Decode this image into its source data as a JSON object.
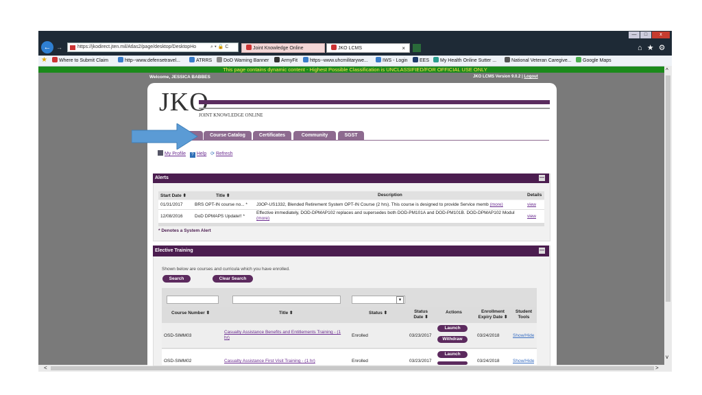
{
  "browser": {
    "url": "https://jkodirect.jten.mil/Atlas2/page/desktop/DesktopHo",
    "search_glyph": "⌕ ▾ 🔒 C",
    "tabs": [
      {
        "label": "Joint Knowledge Online"
      },
      {
        "label": "JKO LCMS"
      }
    ],
    "tab_close": "×",
    "favorites": [
      {
        "label": "Where to Submit Claim"
      },
      {
        "label": "http--www.defensetravel..."
      },
      {
        "label": "ATRRS"
      },
      {
        "label": "DoD Warning Banner"
      },
      {
        "label": "ArmyFit"
      },
      {
        "label": "https--www.uhcmilitarywe..."
      },
      {
        "label": "IWS - Login"
      },
      {
        "label": "EES"
      },
      {
        "label": "My Health Online  Sutter ..."
      },
      {
        "label": "National Veteran Caregive..."
      },
      {
        "label": "Google Maps"
      }
    ],
    "toolbar_icons": "⌂ ★ ⚙",
    "window_buttons": {
      "min": "—",
      "max": "□",
      "close": "x"
    }
  },
  "banner": {
    "text": "This page contains dynamic content - Highest Possible Classification is UNCLASSIFIED/FOR OFFICIAL USE ONLY"
  },
  "header": {
    "welcome": "Welcome, JESSICA BABBES",
    "version": "JKO LCMS Version 9.0.2 |",
    "logout": "Logout",
    "logo": "JKO",
    "logo_sub": "JOINT KNOWLEDGE ONLINE"
  },
  "nav": {
    "tabs": [
      {
        "label": "Course Catalog"
      },
      {
        "label": "Certificates"
      },
      {
        "label": "Community"
      },
      {
        "label": "SGST"
      }
    ]
  },
  "links": {
    "profile": "My Profile",
    "help": "Help",
    "refresh": "Refresh"
  },
  "alerts": {
    "title": "Alerts",
    "collapse": "—",
    "columns": [
      "Start Date ⬍",
      "Title ⬍",
      "Description",
      "Details"
    ],
    "rows": [
      {
        "date": "01/31/2017",
        "title": "BRS OPT-IN course no... *",
        "desc": "J3OP-US1332, Blended Retirement System OPT-IN Course (2 hrs). This course is designed to provide Service memb",
        "more": "(more)",
        "details": "view"
      },
      {
        "date": "12/08/2016",
        "title": "DoD DPMAPS Update!! *",
        "desc": "Effective immediately, DOD-DPMAP102 replaces and supersedes both DOD-PM101A and DOD-PM101B. DOD-DPMAP102 Modul",
        "more": "(more)",
        "details": "view"
      }
    ],
    "footnote": "* Denotes a System Alert"
  },
  "elective": {
    "title": "Elective Training",
    "collapse": "—",
    "intro": "Shown below are courses and curricula which you have enrolled.",
    "search_btn": "Search",
    "clear_btn": "Clear Search",
    "select_arrow": "▾",
    "columns": {
      "course": "Course Number ⬍",
      "title": "Title ⬍",
      "status": "Status ⬍",
      "status_date": "Status Date ⬍",
      "actions": "Actions",
      "expiry": "Enrollment Expiry Date ⬍",
      "tools": "Student Tools"
    },
    "rows": [
      {
        "course": "OSD-SIMM03",
        "title": "Casualty Assistance Benefits and Entitlements Training - (1 hr)",
        "status": "Enrolled",
        "date": "03/23/2017",
        "launch": "Launch",
        "withdraw": "Withdraw",
        "expiry": "03/24/2018",
        "tools": "Show/Hide"
      },
      {
        "course": "OSD-SIMM02",
        "title": "Casualty Assistance First Visit Training - (1 hr)",
        "status": "Enrolled",
        "date": "03/23/2017",
        "launch": "Launch",
        "expiry": "03/24/2018",
        "tools": "Show/Hide"
      }
    ]
  },
  "scroll_glyphs": {
    "up": "^",
    "down": "v",
    "left": "<",
    "right": ">"
  },
  "colors": {
    "accent_purple": "#4b1d4f",
    "tab_purple": "#8d6a8f",
    "banner_green": "#1b8a1b",
    "banner_text": "#ffe34d",
    "arrow_blue": "#5b9bd5"
  }
}
